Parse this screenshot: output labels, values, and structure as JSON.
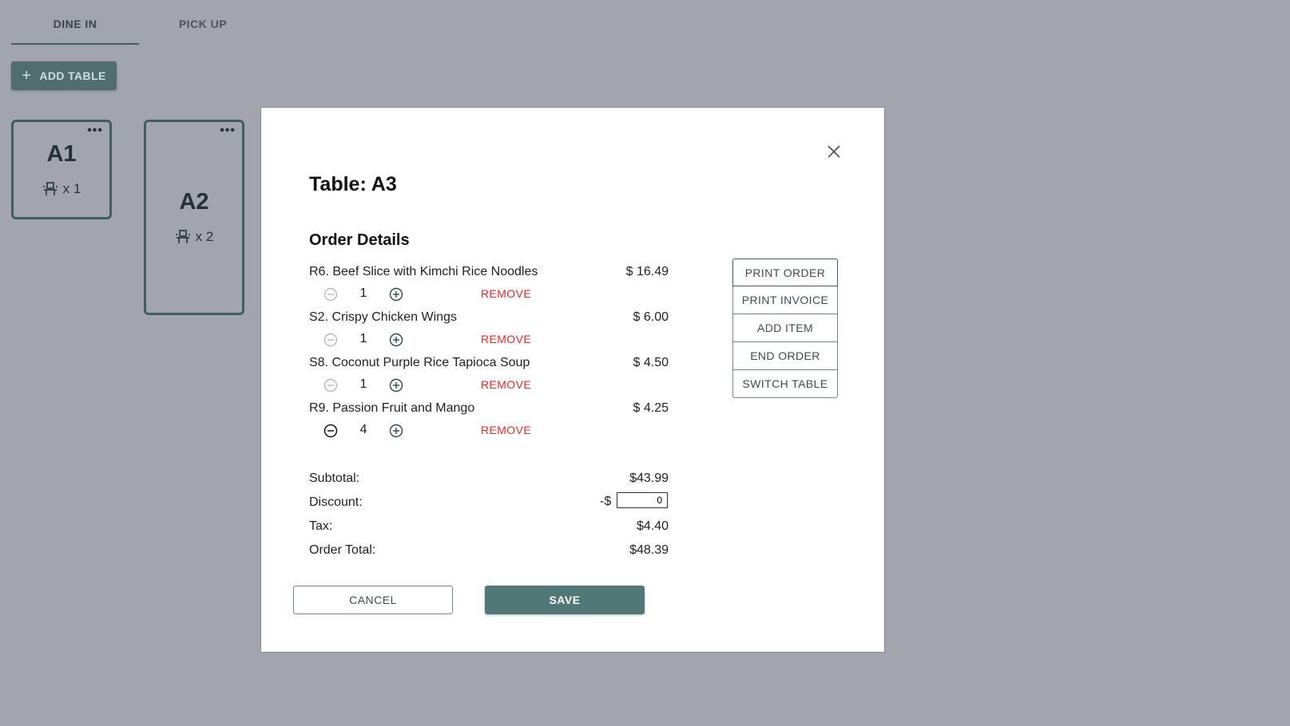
{
  "tabs": [
    {
      "label": "DINE IN",
      "active": true
    },
    {
      "label": "PICK UP",
      "active": false
    }
  ],
  "add_table": {
    "label": "ADD TABLE",
    "icon": "plus-icon"
  },
  "tables": [
    {
      "name": "A1",
      "seats": "x 1",
      "menu_icon": "more-dots-icon",
      "seat_icon": "chair-icon"
    },
    {
      "name": "A2",
      "seats": "x 2",
      "menu_icon": "more-dots-icon",
      "seat_icon": "chair-icon"
    }
  ],
  "modal": {
    "title": "Table: A3",
    "section_title": "Order Details",
    "close_icon": "close-icon",
    "items": [
      {
        "name": "R6. Beef Slice with Kimchi Rice Noodles",
        "price": "$ 16.49",
        "qty": "1",
        "remove": "REMOVE",
        "decrement_enabled": false
      },
      {
        "name": "S2. Crispy Chicken Wings",
        "price": "$ 6.00",
        "qty": "1",
        "remove": "REMOVE",
        "decrement_enabled": false
      },
      {
        "name": "S8. Coconut Purple Rice Tapioca Soup",
        "price": "$ 4.50",
        "qty": "1",
        "remove": "REMOVE",
        "decrement_enabled": false
      },
      {
        "name": "R9. Passion Fruit and Mango",
        "price": "$ 4.25",
        "qty": "4",
        "remove": "REMOVE",
        "decrement_enabled": true
      }
    ],
    "summary": {
      "subtotal_label": "Subtotal:",
      "subtotal_value": "$43.99",
      "discount_label": "Discount:",
      "discount_prefix": "-$",
      "discount_value": "0",
      "tax_label": "Tax:",
      "tax_value": "$4.40",
      "total_label": "Order Total:",
      "total_value": "$48.39"
    },
    "actions": [
      "PRINT ORDER",
      "PRINT INVOICE",
      "ADD ITEM",
      "END ORDER",
      "SWITCH TABLE"
    ],
    "cancel_label": "CANCEL",
    "save_label": "SAVE"
  },
  "colors": {
    "backdrop": "#a2a5ae",
    "accent": "#4f7877",
    "remove": "#e22a2a",
    "card_border": "#3f5f5f"
  }
}
